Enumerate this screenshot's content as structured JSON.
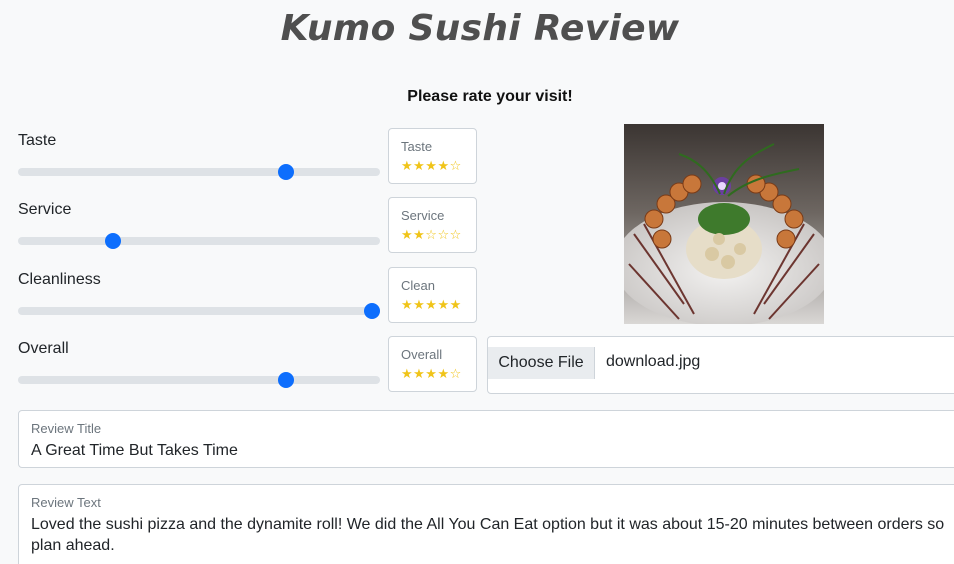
{
  "page": {
    "title": "Kumo Sushi Review",
    "subtitle": "Please rate your visit!"
  },
  "ratings": [
    {
      "label": "Taste",
      "box_label": "Taste",
      "stars": "★★★★☆",
      "value": 4,
      "max": 5
    },
    {
      "label": "Service",
      "box_label": "Service",
      "stars": "★★☆☆☆",
      "value": 2,
      "max": 5
    },
    {
      "label": "Cleanliness",
      "box_label": "Clean",
      "stars": "★★★★★",
      "value": 5,
      "max": 5
    },
    {
      "label": "Overall",
      "box_label": "Overall",
      "stars": "★★★★☆",
      "value": 4,
      "max": 5
    }
  ],
  "photo": {
    "icon": "sushi-photo"
  },
  "file_upload": {
    "button_label": "Choose File",
    "file_name": "download.jpg"
  },
  "review_title": {
    "label": "Review Title",
    "value": "A Great Time But Takes Time"
  },
  "review_text": {
    "label": "Review Text",
    "value": "Loved the sushi pizza and the dynamite roll! We did the All You Can Eat option but it was about 15-20 minutes between orders so plan ahead."
  },
  "colors": {
    "accent": "#0d6efd",
    "star": "#f0c419",
    "title": "#4f4f4f"
  }
}
